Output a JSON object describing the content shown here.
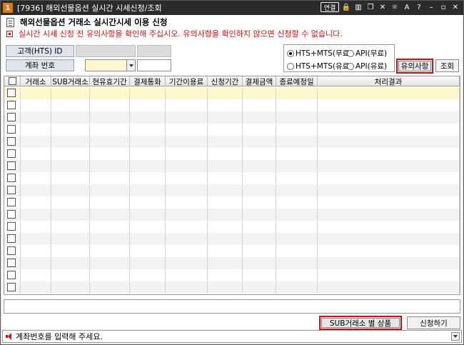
{
  "window": {
    "badge": "1",
    "title": "[7936] 해외선물옵션 실시간 시세신청/조회",
    "link_label": "연결",
    "controls": [
      "⊞",
      "▢",
      "□",
      "✕",
      "☼",
      "A",
      "?",
      "–",
      "▫",
      "✕"
    ]
  },
  "header": {
    "title": "해외선물옵션 거래소 실시간시세 이용 신청",
    "notice": "실시간 시세 신청 전 유의사항을 확인해 주십시오. 유의사항을 확인하지 않으면 신청할 수 없습니다."
  },
  "form": {
    "customer_label": "고객(HTS) ID",
    "account_label": "계좌 번호",
    "account_value": "",
    "account_pw_value": ""
  },
  "radios": [
    {
      "label": "HTS+MTS(무료)",
      "checked": true
    },
    {
      "label": "API(무료)",
      "checked": false
    },
    {
      "label": "HTS+MTS(유료)",
      "checked": false
    },
    {
      "label": "API(유료)",
      "checked": false
    }
  ],
  "buttons": {
    "notice": "유의사항",
    "query": "조회",
    "sub_exchange": "SUB거래소 별 상품",
    "apply": "신청하기"
  },
  "table": {
    "columns": [
      "",
      "거래소",
      "SUB거래소",
      "현유효기간",
      "결제통화",
      "기간이용료",
      "신청기간",
      "결제금액",
      "종료예정일",
      "처리결과"
    ],
    "row_count": 17
  },
  "status": {
    "message": "계좌번호를 입력해 주세요."
  },
  "colors": {
    "highlight_row": "#fdf6cf",
    "alert_red": "#d81010",
    "title_bar": "#2b2b2b"
  }
}
